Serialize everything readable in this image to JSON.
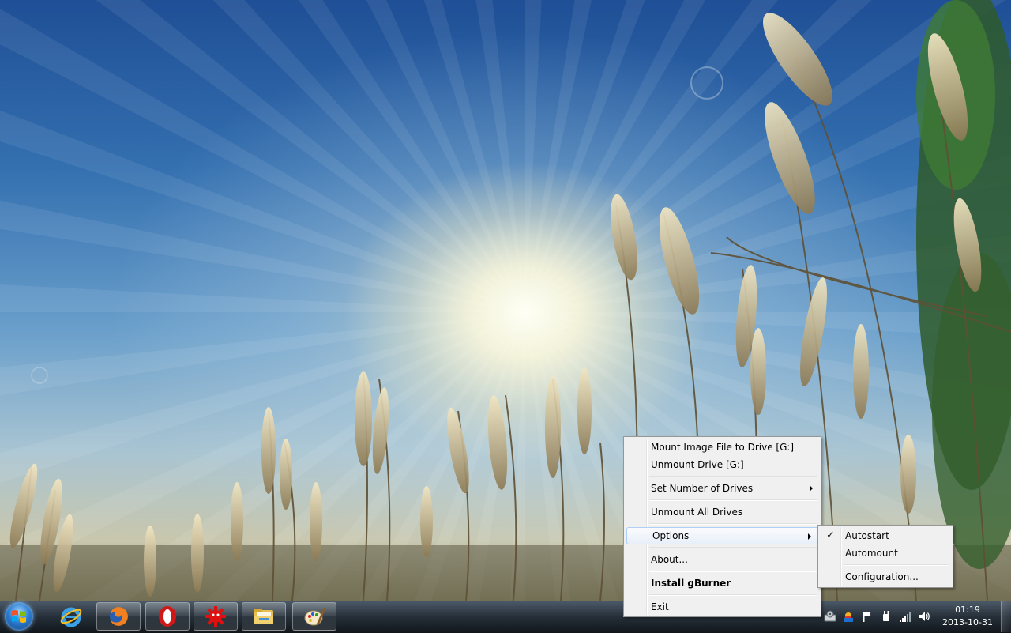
{
  "context_menu": {
    "items": [
      {
        "label": "Mount Image File to Drive [G:]"
      },
      {
        "label": "Unmount Drive [G:]"
      },
      {
        "label": "Set Number of Drives"
      },
      {
        "label": "Unmount All Drives"
      },
      {
        "label": "Options"
      },
      {
        "label": "About..."
      },
      {
        "label": "Install gBurner"
      },
      {
        "label": "Exit"
      }
    ]
  },
  "options_submenu": {
    "items": [
      {
        "label": "Autostart",
        "checked": true
      },
      {
        "label": "Automount",
        "checked": false
      },
      {
        "label": "Configuration..."
      }
    ]
  },
  "taskbar": {
    "pinned": [
      {
        "icon": "windows-start-icon"
      },
      {
        "icon": "internet-explorer-icon"
      },
      {
        "icon": "firefox-icon"
      },
      {
        "icon": "opera-icon"
      },
      {
        "icon": "red-gear-app-icon"
      },
      {
        "icon": "file-explorer-icon"
      },
      {
        "icon": "paint-icon"
      }
    ],
    "tray_icons": [
      "gburner-tray-icon",
      "weather-tray-icon",
      "action-center-flag-icon",
      "power-icon",
      "network-signal-icon",
      "volume-icon"
    ],
    "clock": {
      "time": "01:19",
      "date": "2013-10-31"
    }
  },
  "colors": {
    "menu_background": "#f0f0f0",
    "menu_highlight_border": "#aecff7"
  }
}
